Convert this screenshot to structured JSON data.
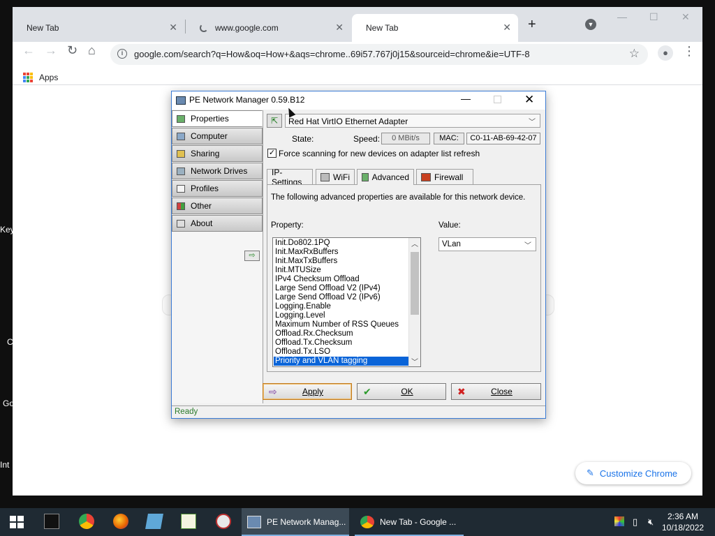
{
  "desktop": {
    "edge_labels": [
      "Key",
      "C",
      "Go",
      "Int"
    ]
  },
  "browser": {
    "tabs": [
      {
        "title": "New Tab",
        "loading": false,
        "active": false
      },
      {
        "title": "www.google.com",
        "loading": true,
        "active": false
      },
      {
        "title": "New Tab",
        "loading": false,
        "active": true
      }
    ],
    "url": "google.com/search?q=How&oq=How+&aqs=chrome..69i57.767j0j15&sourceid=chrome&ie=UTF-8",
    "bookmarks_bar": {
      "apps_label": "Apps"
    },
    "customize_label": "Customize Chrome"
  },
  "pe_window": {
    "title": "PE Network Manager 0.59.B12",
    "sidebar": [
      {
        "label": "Properties",
        "active": true
      },
      {
        "label": "Computer",
        "active": false
      },
      {
        "label": "Sharing",
        "active": false
      },
      {
        "label": "Network Drives",
        "active": false
      },
      {
        "label": "Profiles",
        "active": false
      },
      {
        "label": "Other",
        "active": false
      },
      {
        "label": "About",
        "active": false
      }
    ],
    "adapter": "Red Hat VirtIO Ethernet Adapter",
    "state_label": "State:",
    "speed_label": "Speed:",
    "speed_value": "0 MBit/s",
    "mac_label": "MAC:",
    "mac_value": "C0-11-AB-69-42-07",
    "force_scan_label": "Force scanning for new devices on adapter list refresh",
    "force_scan_checked": true,
    "tabs": [
      {
        "label": "IP-Settings",
        "active": false
      },
      {
        "label": "WiFi",
        "active": false
      },
      {
        "label": "Advanced",
        "active": true
      },
      {
        "label": "Firewall",
        "active": false
      }
    ],
    "advanced": {
      "description": "The following advanced properties are available for this network device.",
      "property_label": "Property:",
      "value_label": "Value:",
      "properties": [
        "Init.Do802.1PQ",
        "Init.MaxRxBuffers",
        "Init.MaxTxBuffers",
        "Init.MTUSize",
        "IPv4 Checksum Offload",
        "Large Send Offload V2 (IPv4)",
        "Large Send Offload V2 (IPv6)",
        "Logging.Enable",
        "Logging.Level",
        "Maximum Number of RSS Queues",
        "Offload.Rx.Checksum",
        "Offload.Tx.Checksum",
        "Offload.Tx.LSO",
        "Priority and VLAN tagging"
      ],
      "selected_property": "Priority and VLAN tagging",
      "value": "VLan"
    },
    "buttons": {
      "apply": "Apply",
      "ok": "OK",
      "close": "Close"
    },
    "status": "Ready"
  },
  "taskbar": {
    "items": [
      {
        "label": "PE Network Manag...",
        "active": true
      },
      {
        "label": "New Tab - Google ...",
        "active": false
      }
    ],
    "time": "2:36 AM",
    "date": "10/18/2022"
  },
  "colors": {
    "selection": "#0a64d8",
    "status_text": "#2a7a2a",
    "chrome_accent": "#1a73e8",
    "taskbar": "#1f2a33"
  }
}
